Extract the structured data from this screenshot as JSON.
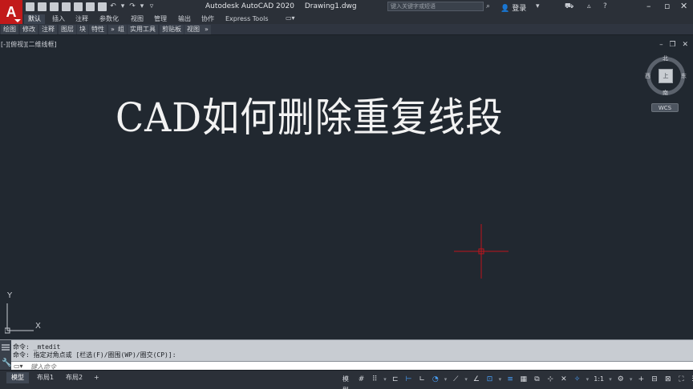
{
  "app": {
    "logo_letter": "A",
    "title": "Autodesk AutoCAD 2020",
    "document": "Drawing1.dwg"
  },
  "quick_access": [
    "new-icon",
    "open-icon",
    "save-icon",
    "save-as-icon",
    "cloud-open-icon",
    "cloud-save-icon",
    "plot-icon",
    "undo-icon",
    "redo-icon",
    "customize-icon"
  ],
  "header": {
    "search_placeholder": "键入关键字或短语",
    "login_label": "登录"
  },
  "ribbon": {
    "tabs": [
      "默认",
      "插入",
      "注释",
      "参数化",
      "视图",
      "管理",
      "输出",
      "协作",
      "Express Tools"
    ],
    "active_tab": 0
  },
  "panels": [
    "绘图",
    "修改",
    "注释",
    "图层",
    "块",
    "特性",
    "组",
    "实用工具",
    "剪贴板",
    "视图"
  ],
  "canvas": {
    "viewport_label": "[-][俯视][二维线框]",
    "title_text": "CAD如何删除重复线段",
    "compass": {
      "north": "北",
      "south": "南",
      "east": "东",
      "west": "西",
      "top": "上"
    },
    "wcs_label": "WCS",
    "ucs_x": "X",
    "ucs_y": "Y",
    "accent_colors": {
      "crosshair": "#c0141c",
      "logo": "#c21a1a",
      "status_on": "#4aa3ff"
    }
  },
  "command": {
    "history": [
      "命令:  _mtedit",
      "命令: 指定对角点或 [栏选(F)/圈围(WP)/圈交(CP)]:"
    ],
    "input_placeholder": "键入命令"
  },
  "layout_tabs": [
    "模型",
    "布局1",
    "布局2"
  ],
  "add_layout": "+",
  "status": {
    "model_label": "模型",
    "scale_label": "1:1"
  }
}
